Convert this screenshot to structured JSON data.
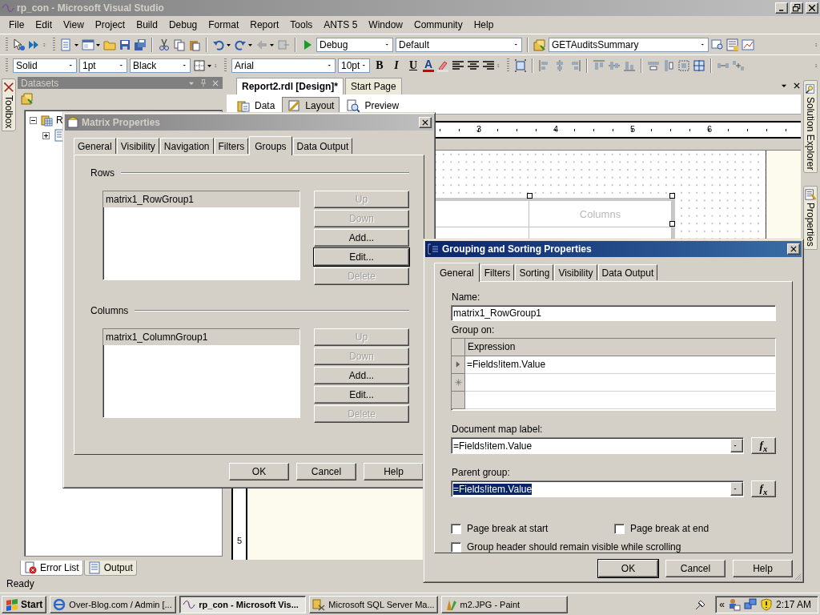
{
  "window": {
    "title": "rp_con - Microsoft Visual Studio",
    "active": false
  },
  "menu": [
    "File",
    "Edit",
    "View",
    "Project",
    "Build",
    "Debug",
    "Format",
    "Report",
    "Tools",
    "ANTS 5",
    "Window",
    "Community",
    "Help"
  ],
  "toolbar_standard": {
    "combos": [
      "Debug",
      "Default",
      "GETAuditsSummary"
    ]
  },
  "toolbar_report": {
    "combos": [
      "Solid",
      "1pt",
      "Black",
      "Arial",
      "10pt"
    ],
    "format_buttons": [
      "B",
      "I",
      "U"
    ],
    "font_color_button": "A"
  },
  "toolbox_tab": {
    "label": "Toolbox"
  },
  "datasets_panel": {
    "title": "Datasets",
    "tree": [
      {
        "label": "R",
        "expanded": true,
        "children": [
          {
            "expanded": false
          }
        ]
      }
    ]
  },
  "document_tabs": [
    {
      "label": "Report2.rdl [Design]*",
      "selected": true
    },
    {
      "label": "Start Page",
      "selected": false
    }
  ],
  "view_tabs": [
    {
      "label": "Data",
      "selected": false
    },
    {
      "label": "Layout",
      "selected": true
    },
    {
      "label": "Preview",
      "selected": false
    }
  ],
  "ruler": {
    "labels": [
      "3",
      "4",
      "5",
      "6"
    ]
  },
  "vertical_ruler": {
    "labels": [
      "5"
    ]
  },
  "matrix": {
    "column_header": "Columns"
  },
  "side_tabs": [
    {
      "label": "Solution Explorer"
    },
    {
      "label": "Properties"
    }
  ],
  "bottom_tabs": [
    {
      "label": "Error List",
      "selected": true
    },
    {
      "label": "Output",
      "selected": false
    }
  ],
  "status_bar": {
    "text": "Ready"
  },
  "matrix_dialog": {
    "title": "Matrix Properties",
    "active": false,
    "tabs": [
      {
        "label": "General",
        "selected": false
      },
      {
        "label": "Visibility",
        "selected": false
      },
      {
        "label": "Navigation",
        "selected": false
      },
      {
        "label": "Filters",
        "selected": false
      },
      {
        "label": "Groups",
        "selected": true
      },
      {
        "label": "Data Output",
        "selected": false
      }
    ],
    "sections": [
      {
        "label": "Rows",
        "items": [
          {
            "label": "matrix1_RowGroup1",
            "selected": true
          }
        ],
        "buttons": [
          {
            "label": "Up",
            "disabled": true,
            "default": false
          },
          {
            "label": "Down",
            "disabled": true,
            "default": false
          },
          {
            "label": "Add...",
            "disabled": false,
            "default": false
          },
          {
            "label": "Edit...",
            "disabled": false,
            "default": true
          },
          {
            "label": "Delete",
            "disabled": true,
            "default": false
          }
        ]
      },
      {
        "label": "Columns",
        "items": [
          {
            "label": "matrix1_ColumnGroup1",
            "selected": true
          }
        ],
        "buttons": [
          {
            "label": "Up",
            "disabled": true,
            "default": false
          },
          {
            "label": "Down",
            "disabled": true,
            "default": false
          },
          {
            "label": "Add...",
            "disabled": false,
            "default": false
          },
          {
            "label": "Edit...",
            "disabled": false,
            "default": false
          },
          {
            "label": "Delete",
            "disabled": true,
            "default": false
          }
        ]
      }
    ],
    "buttons": [
      {
        "label": "OK",
        "default": false
      },
      {
        "label": "Cancel",
        "default": false
      },
      {
        "label": "Help",
        "default": false
      }
    ]
  },
  "grouping_dialog": {
    "title": "Grouping and Sorting Properties",
    "active": true,
    "tabs": [
      {
        "label": "General",
        "selected": true
      },
      {
        "label": "Filters",
        "selected": false
      },
      {
        "label": "Sorting",
        "selected": false
      },
      {
        "label": "Visibility",
        "selected": false
      },
      {
        "label": "Data Output",
        "selected": false
      }
    ],
    "name": {
      "label": "Name:",
      "value": "matrix1_RowGroup1"
    },
    "group_on": {
      "label": "Group on:",
      "column": "Expression",
      "rows": [
        {
          "kind": "current",
          "expression": "=Fields!item.Value"
        },
        {
          "kind": "new"
        },
        {
          "kind": "empty"
        }
      ]
    },
    "document_map_label": {
      "label": "Document map label:",
      "value": "=Fields!item.Value",
      "value_selected": false,
      "expression_button": "f$_{x}$"
    },
    "parent_group": {
      "label": "Parent group:",
      "value": "=Fields!item.Value",
      "value_selected": true,
      "expression_button": "f$_{x}$"
    },
    "checkboxes": [
      {
        "label": "Page break at start",
        "checked": false
      },
      {
        "label": "Page break at end",
        "checked": false
      },
      {
        "label": "Group header should remain visible while scrolling",
        "checked": false
      }
    ],
    "buttons": [
      {
        "label": "OK",
        "default": true
      },
      {
        "label": "Cancel",
        "default": false
      },
      {
        "label": "Help",
        "default": false
      }
    ]
  },
  "taskbar": {
    "start": "Start",
    "tasks": [
      {
        "label": "Over-Blog.com / Admin [...",
        "selected": false
      },
      {
        "label": "rp_con - Microsoft Vis...",
        "selected": true
      },
      {
        "label": "Microsoft SQL Server Ma...",
        "selected": false
      },
      {
        "label": "m2.JPG - Paint",
        "selected": false
      }
    ],
    "tray_expand": "«",
    "time": "2:17 AM"
  }
}
